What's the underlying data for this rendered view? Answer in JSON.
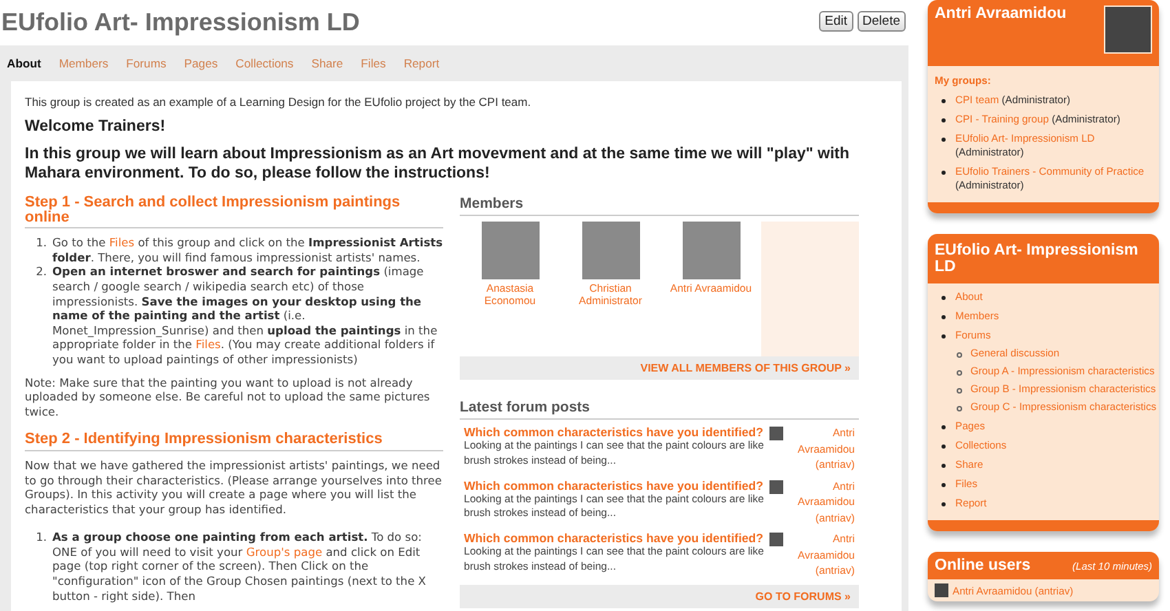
{
  "group": {
    "title": "EUfolio Art- Impressionism LD",
    "buttons": [
      "Edit",
      "Delete"
    ]
  },
  "tabs": [
    {
      "label": "About",
      "selected": true
    },
    {
      "label": "Members",
      "selected": false
    },
    {
      "label": "Forums",
      "selected": false
    },
    {
      "label": "Pages",
      "selected": false
    },
    {
      "label": "Collections",
      "selected": false
    },
    {
      "label": "Share",
      "selected": false
    },
    {
      "label": "Files",
      "selected": false
    },
    {
      "label": "Report",
      "selected": false
    }
  ],
  "about": {
    "intro": "This group is created as an example of a Learning Design for the EUfolio project by the CPI team.",
    "welcome": "Welcome Trainers!",
    "lead": "In this group we will learn about Impressionism as an Art movevment and at the same time we will \"play\" with Mahara environment. To do so, please follow the instructions!"
  },
  "steps": [
    {
      "heading": "Step 1 - Search and collect Impressionism paintings online",
      "items": [
        {
          "number": "1.",
          "segments": [
            {
              "kind": "text",
              "text": "Go to the "
            },
            {
              "kind": "link",
              "text": "Files"
            },
            {
              "kind": "text",
              "text": " of this group and click on the **Impressionist Artists folder**. There, you will find famous impressionist artists' names."
            }
          ]
        },
        {
          "number": "2.",
          "segments": [
            {
              "kind": "text",
              "text": "**Open an internet broswer and search for paintings** (image search / google search / wikipedia search etc) of those impressionists. **Save the images on your desktop using the name of the painting and the artist** (i.e. Monet_Impression_Sunrise) and then **upload the paintings** in the appropriate folder in the "
            },
            {
              "kind": "link",
              "text": "Files"
            },
            {
              "kind": "text",
              "text": ". (You may create additional folders if you want to upload paintings of other impressionists)"
            }
          ]
        }
      ],
      "note": "Note: Make sure that the painting you want to upload is not already uploaded by someone else. Be careful not to upload the same pictures twice."
    },
    {
      "heading": "Step 2 - Identifying Impressionism characteristics",
      "paragraphs": [
        "Now that we have gathered the impressionist artists' paintings, we need to go through their characteristics. (Please arrange yourselves into three Groups). In this activity you will create a page where you will list the characteristics that your group has identified."
      ],
      "items": [
        {
          "number": "1.",
          "segments": [
            {
              "kind": "text",
              "text": "**As a group choose one painting from each artist.** To do so: ONE of you will need to visit your "
            },
            {
              "kind": "link",
              "text": "Group's page"
            },
            {
              "kind": "text",
              "text": " and click on Edit page (top right corner of the screen). Then Click on the \"configuration\" icon of the Group Chosen paintings (next to the X button - right side). Then"
            }
          ]
        }
      ]
    }
  ],
  "members": {
    "heading": "Members",
    "people": [
      {
        "name": "Anastasia Economou"
      },
      {
        "name": "Christian Administrator"
      },
      {
        "name": "Antri Avraamidou"
      }
    ],
    "more": "VIEW ALL MEMBERS OF THIS GROUP »"
  },
  "forum": {
    "heading": "Latest forum posts",
    "posts": [
      {
        "title": "Which common characteristics have you identified?",
        "excerpt": "Looking at the paintings I can see that the paint colours are like brush strokes instead of being...",
        "author": "Antri Avraamidou (antriav)"
      },
      {
        "title": "Which common characteristics have you identified?",
        "excerpt": "Looking at the paintings I can see that the paint colours are like brush strokes instead of being...",
        "author": "Antri Avraamidou (antriav)"
      },
      {
        "title": "Which common characteristics have you identified?",
        "excerpt": "Looking at the paintings I can see that the paint colours are like brush strokes instead of being...",
        "author": "Antri Avraamidou (antriav)"
      }
    ],
    "more": "GO TO FORUMS »"
  },
  "sidebar": {
    "profile": {
      "name": "Antri Avraamidou",
      "groups_label": "My groups:",
      "groups": [
        {
          "name": "CPI team",
          "role": "(Administrator)"
        },
        {
          "name": "CPI - Training group",
          "role": "(Administrator)"
        },
        {
          "name": "EUfolio Art- Impressionism LD",
          "role": "(Administrator)"
        },
        {
          "name": "EUfolio Trainers - Community of Practice",
          "role": "(Administrator)"
        }
      ]
    },
    "group_menu": {
      "title": "EUfolio Art- Impressionism LD",
      "items": [
        {
          "label": "About"
        },
        {
          "label": "Members"
        },
        {
          "label": "Forums",
          "children": [
            {
              "label": "General discussion"
            },
            {
              "label": "Group A - Impressionism characteristics"
            },
            {
              "label": "Group B - Impressionism characteristics"
            },
            {
              "label": "Group C - Impressionism characteristics"
            }
          ]
        },
        {
          "label": "Pages"
        },
        {
          "label": "Collections"
        },
        {
          "label": "Share"
        },
        {
          "label": "Files"
        },
        {
          "label": "Report"
        }
      ]
    },
    "online": {
      "title": "Online users",
      "note": "(Last 10 minutes)",
      "users": [
        "Antri Avraamidou (antriav)"
      ]
    }
  }
}
